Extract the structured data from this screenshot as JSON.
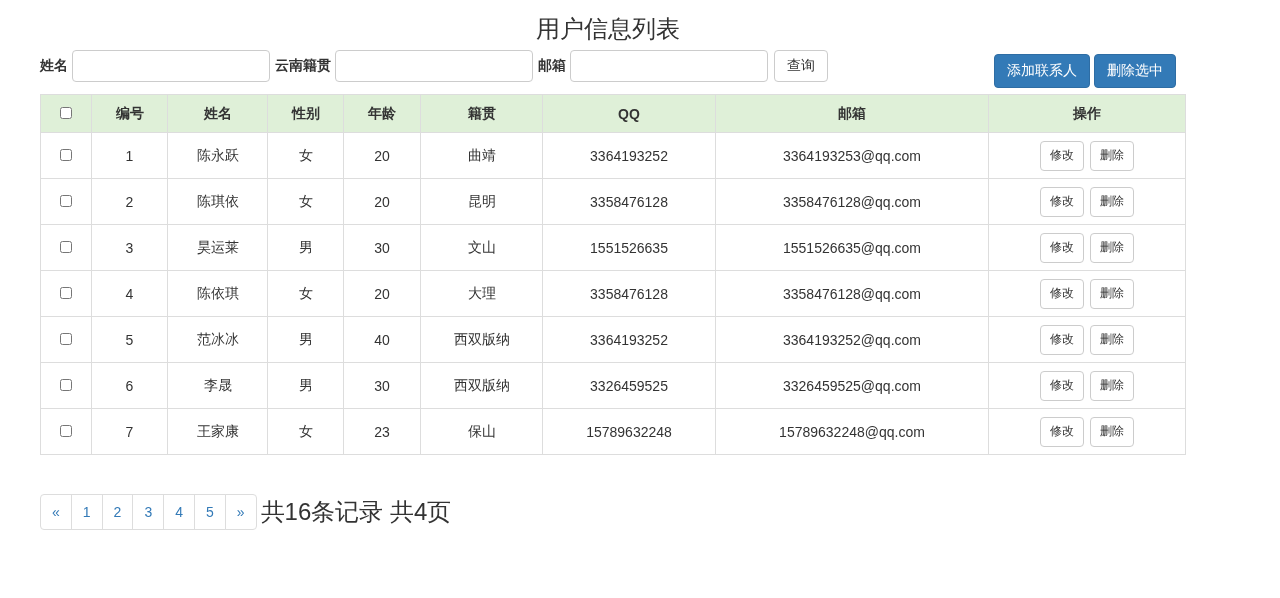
{
  "title": "用户信息列表",
  "search": {
    "fields": [
      {
        "label": "姓名"
      },
      {
        "label": "云南籍贯"
      },
      {
        "label": "邮箱"
      }
    ],
    "button": "查询"
  },
  "actions": [
    "添加联系人",
    "删除选中"
  ],
  "table": {
    "select_all_checked": false,
    "columns": [
      "编号",
      "姓名",
      "性别",
      "年龄",
      "籍贯",
      "QQ",
      "邮箱",
      "操作"
    ],
    "rows": [
      {
        "checked": false,
        "cells": [
          "1",
          "陈永跃",
          "女",
          "20",
          "曲靖",
          "3364193252",
          "3364193253@qq.com"
        ],
        "buttons": [
          "修改",
          "删除"
        ]
      },
      {
        "checked": false,
        "cells": [
          "2",
          "陈琪依",
          "女",
          "20",
          "昆明",
          "3358476128",
          "3358476128@qq.com"
        ],
        "buttons": [
          "修改",
          "删除"
        ]
      },
      {
        "checked": false,
        "cells": [
          "3",
          "昊运莱",
          "男",
          "30",
          "文山",
          "1551526635",
          "1551526635@qq.com"
        ],
        "buttons": [
          "修改",
          "删除"
        ]
      },
      {
        "checked": false,
        "cells": [
          "4",
          "陈依琪",
          "女",
          "20",
          "大理",
          "3358476128",
          "3358476128@qq.com"
        ],
        "buttons": [
          "修改",
          "删除"
        ]
      },
      {
        "checked": false,
        "cells": [
          "5",
          "范冰冰",
          "男",
          "40",
          "西双版纳",
          "3364193252",
          "3364193252@qq.com"
        ],
        "buttons": [
          "修改",
          "删除"
        ]
      },
      {
        "checked": false,
        "cells": [
          "6",
          "李晟",
          "男",
          "30",
          "西双版纳",
          "3326459525",
          "3326459525@qq.com"
        ],
        "buttons": [
          "修改",
          "删除"
        ]
      },
      {
        "checked": false,
        "cells": [
          "7",
          "王家康",
          "女",
          "23",
          "保山",
          "15789632248",
          "15789632248@qq.com"
        ],
        "buttons": [
          "修改",
          "删除"
        ]
      }
    ]
  },
  "pagination": {
    "prev": "«",
    "pages": [
      {
        "label": "1",
        "selected": false
      },
      {
        "label": "2",
        "selected": false
      },
      {
        "label": "3",
        "selected": false
      },
      {
        "label": "4",
        "selected": false
      },
      {
        "label": "5",
        "selected": false
      }
    ],
    "next": "»",
    "summary": "共16条记录 共4页"
  }
}
